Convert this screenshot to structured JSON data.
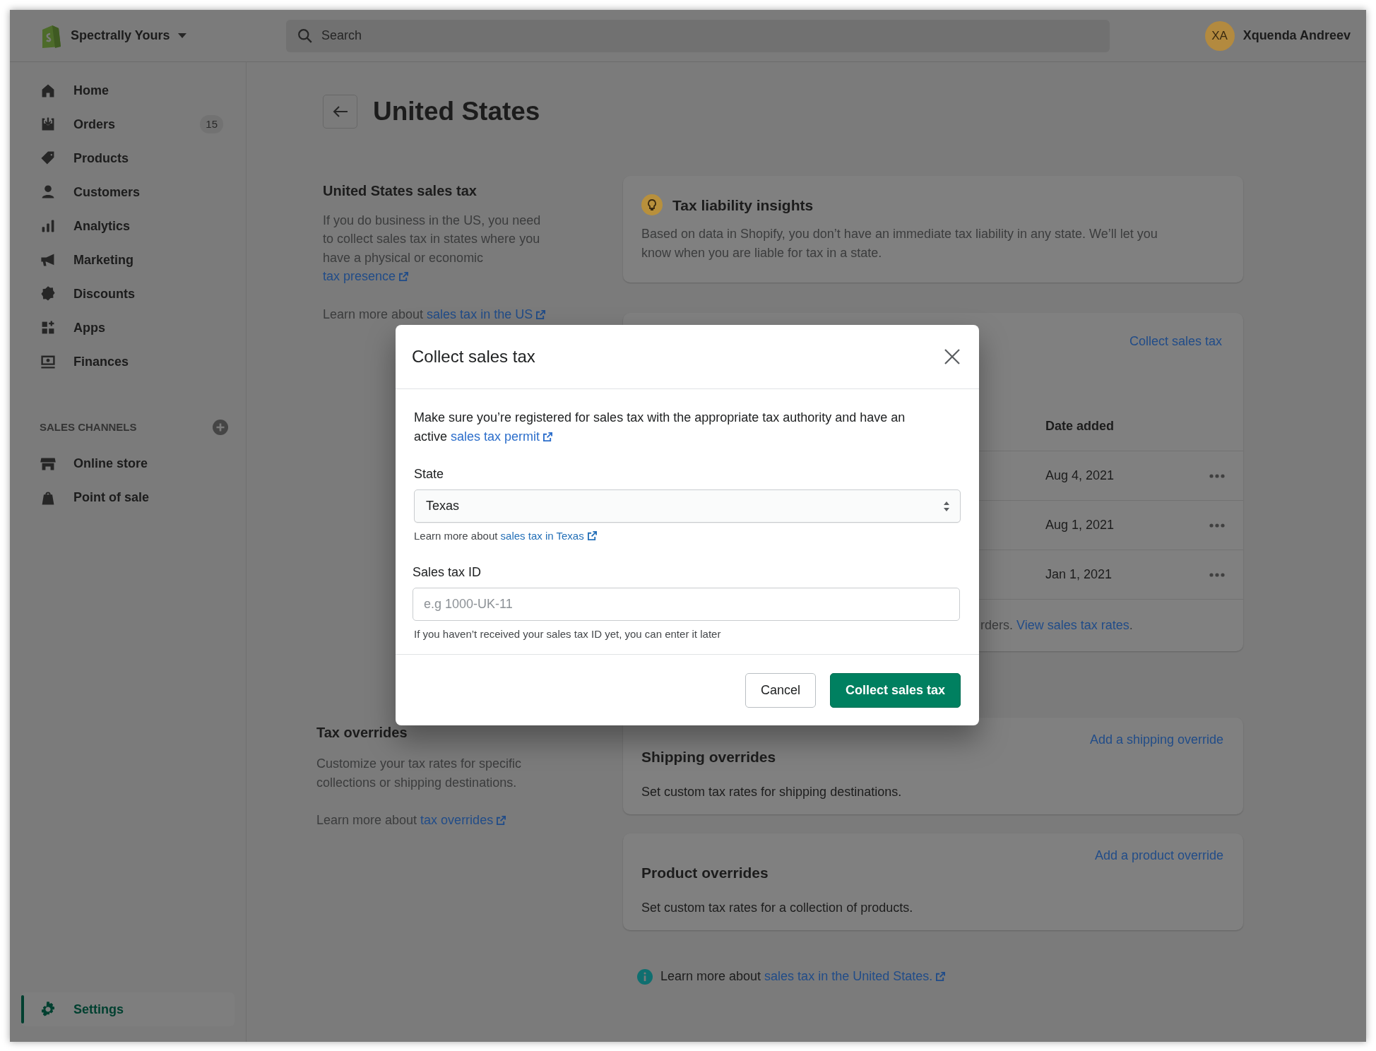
{
  "top_bar": {
    "store_name": "Spectrally Yours",
    "search": {
      "placeholder": "Search"
    },
    "user": {
      "initials": "XA",
      "name": "Xquenda Andreev"
    }
  },
  "sidebar": {
    "items": [
      {
        "label": "Home",
        "selected": false
      },
      {
        "label": "Orders",
        "badge": "15",
        "selected": false
      },
      {
        "label": "Products",
        "selected": false
      },
      {
        "label": "Customers",
        "selected": false
      },
      {
        "label": "Analytics",
        "selected": false
      },
      {
        "label": "Marketing",
        "selected": false
      },
      {
        "label": "Discounts",
        "selected": false
      },
      {
        "label": "Apps",
        "selected": false
      },
      {
        "label": "Finances",
        "selected": false
      }
    ],
    "sales_channels": {
      "heading": "SALES CHANNELS",
      "items": [
        {
          "label": "Online store",
          "selected": false
        },
        {
          "label": "Point of sale",
          "selected": false
        }
      ]
    },
    "bottom_items": [
      {
        "label": "Settings",
        "selected": true
      }
    ]
  },
  "page": {
    "title": "United States",
    "sales_tax_section": {
      "heading": "United States sales tax",
      "description": {
        "text": "If you do business in the US, you need to collect sales tax in states where you have a physical or economic ",
        "link": "tax presence"
      },
      "learn_more": {
        "text": "Learn more about ",
        "link": "sales tax in the US"
      }
    },
    "insights_card": {
      "title": "Tax liability insights",
      "body": "Based on data in Shopify, you don’t have an immediate tax liability in any state. We’ll let you know when you are liable for tax in a state."
    },
    "registrations_card": {
      "action": "Collect sales tax",
      "columns": [
        "Date added"
      ],
      "rows": [
        {
          "date_added": "Aug 4, 2021"
        },
        {
          "date_added": "Aug 1, 2021"
        },
        {
          "date_added": "Jan 1, 2021"
        }
      ],
      "footer": {
        "text": "rders. ",
        "link": "View sales tax rates",
        "end": "."
      }
    },
    "overrides_section": {
      "heading": "Tax overrides",
      "description": "Customize your tax rates for specific collections or shipping destinations.",
      "learn_more": {
        "text": "Learn more about ",
        "link": "tax overrides"
      }
    },
    "override_cards": [
      {
        "title": "Shipping overrides",
        "action": "Add a shipping override",
        "body": "Set custom tax rates for shipping destinations."
      },
      {
        "title": "Product overrides",
        "action": "Add a product override",
        "body": "Set custom tax rates for a collection of products."
      }
    ],
    "footer_note": {
      "text": "Learn more about ",
      "link": "sales tax in the United States."
    }
  },
  "modal": {
    "title": "Collect sales tax",
    "intro": {
      "text": "Make sure you’re registered for sales tax with the appropriate tax authority and have an active ",
      "link": "sales tax permit"
    },
    "state_field": {
      "label": "State",
      "value": "Texas",
      "help": {
        "text": "Learn more about ",
        "link": "sales tax in Texas"
      }
    },
    "tax_id_field": {
      "label": "Sales tax ID",
      "placeholder": "e.g 1000-UK-11",
      "help": "If you haven’t received your sales tax ID yet, you can enter it later"
    },
    "buttons": [
      {
        "label": "Cancel",
        "kind": "secondary"
      },
      {
        "label": "Collect sales tax",
        "kind": "primary"
      }
    ]
  }
}
